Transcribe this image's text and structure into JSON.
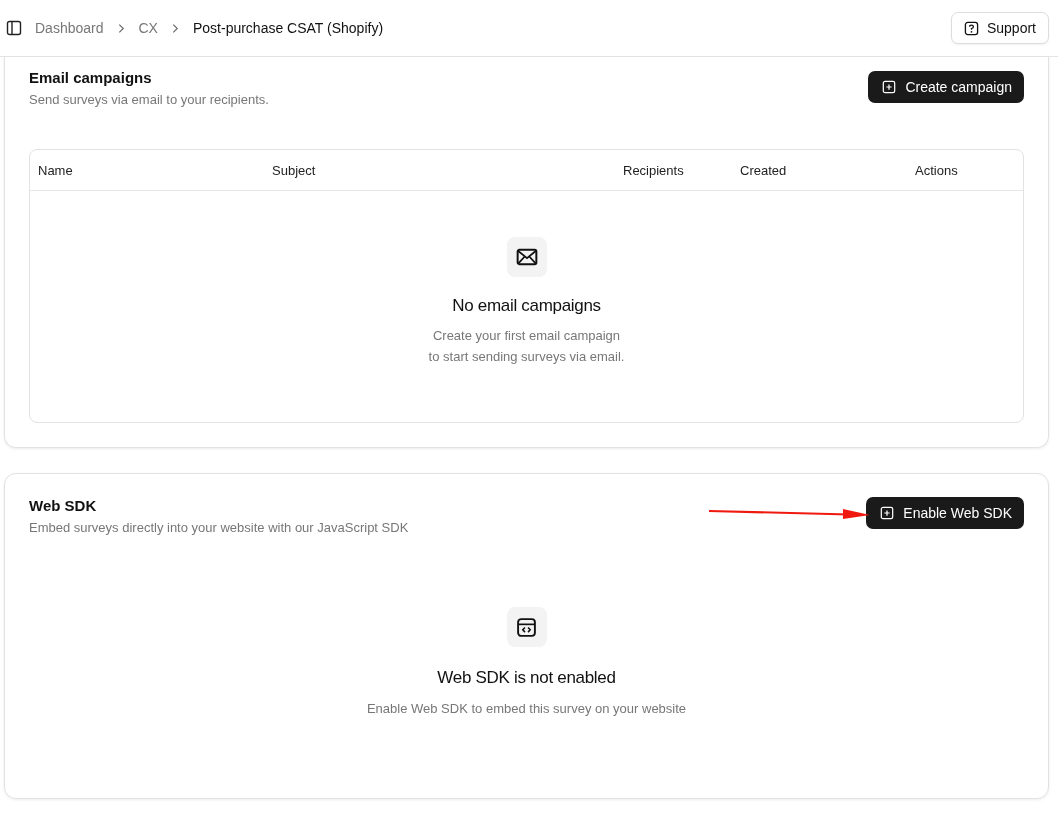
{
  "breadcrumbs": [
    {
      "label": "Dashboard",
      "current": false
    },
    {
      "label": "CX",
      "current": false
    },
    {
      "label": "Post-purchase CSAT (Shopify)",
      "current": true
    }
  ],
  "support_button": "Support",
  "email_campaigns": {
    "title": "Email campaigns",
    "subtitle": "Send surveys via email to your recipients.",
    "button": "Create campaign",
    "columns": [
      "Name",
      "Subject",
      "Recipients",
      "Created",
      "Actions"
    ],
    "empty_title": "No email campaigns",
    "empty_lines": [
      "Create your first email campaign",
      "to start sending surveys via email."
    ]
  },
  "web_sdk": {
    "title": "Web SDK",
    "subtitle": "Embed surveys directly into your website with our JavaScript SDK",
    "button": "Enable Web SDK",
    "empty_title": "Web SDK is not enabled",
    "empty_text": "Enable Web SDK to embed this survey on your website"
  }
}
